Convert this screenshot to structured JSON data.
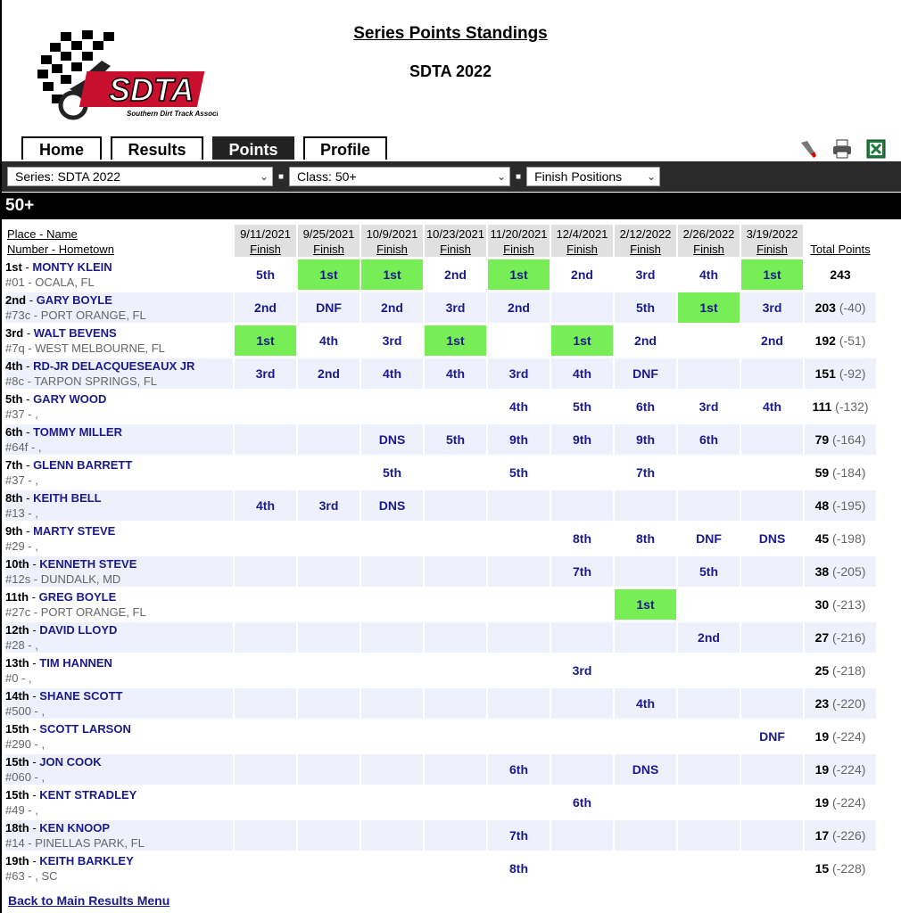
{
  "header": {
    "title": "Series Points Standings",
    "subtitle": "SDTA 2022",
    "logo_text": "SDTA",
    "logo_tagline": "Southern Dirt Track Association"
  },
  "tabs": [
    {
      "label": "Home",
      "active": false
    },
    {
      "label": "Results",
      "active": false
    },
    {
      "label": "Points",
      "active": true
    },
    {
      "label": "Profile",
      "active": false
    }
  ],
  "tools": [
    {
      "icon": "flashlight-icon"
    },
    {
      "icon": "printer-icon"
    },
    {
      "icon": "excel-icon"
    }
  ],
  "filters": {
    "series": "Series: SDTA 2022",
    "class": "Class: 50+",
    "view": "Finish Positions"
  },
  "class_name": "50+",
  "columns": {
    "place_name": "Place - Name",
    "number_hometown": "Number - Hometown",
    "finish_label": "Finish",
    "total_label": "Total Points",
    "dates": [
      "9/11/2021",
      "9/25/2021",
      "10/9/2021",
      "10/23/2021",
      "11/20/2021",
      "12/4/2021",
      "2/12/2022",
      "2/26/2022",
      "3/19/2022"
    ]
  },
  "rows": [
    {
      "place": "1st",
      "name": "MONTY KLEIN",
      "sub": "#01 - OCALA, FL",
      "results": [
        "5th",
        "1st",
        "1st",
        "2nd",
        "1st",
        "2nd",
        "3rd",
        "4th",
        "1st"
      ],
      "total": "243",
      "diff": ""
    },
    {
      "place": "2nd",
      "name": "GARY BOYLE",
      "sub": "#73c - PORT ORANGE, FL",
      "results": [
        "2nd",
        "DNF",
        "2nd",
        "3rd",
        "2nd",
        "",
        "5th",
        "1st",
        "3rd"
      ],
      "total": "203",
      "diff": "(-40)"
    },
    {
      "place": "3rd",
      "name": "WALT BEVENS",
      "sub": "#7q - WEST MELBOURNE, FL",
      "results": [
        "1st",
        "4th",
        "3rd",
        "1st",
        "",
        "1st",
        "2nd",
        "",
        "2nd"
      ],
      "total": "192",
      "diff": "(-51)"
    },
    {
      "place": "4th",
      "name": "RD-JR DELACQUESEAUX JR",
      "sub": "#8c - TARPON SPRINGS, FL",
      "results": [
        "3rd",
        "2nd",
        "4th",
        "4th",
        "3rd",
        "4th",
        "DNF",
        "",
        ""
      ],
      "total": "151",
      "diff": "(-92)"
    },
    {
      "place": "5th",
      "name": "GARY WOOD",
      "sub": "#37 - ,",
      "results": [
        "",
        "",
        "",
        "",
        "4th",
        "5th",
        "6th",
        "3rd",
        "4th"
      ],
      "total": "111",
      "diff": "(-132)"
    },
    {
      "place": "6th",
      "name": "TOMMY MILLER",
      "sub": "#64f - ,",
      "results": [
        "",
        "",
        "DNS",
        "5th",
        "9th",
        "9th",
        "9th",
        "6th",
        ""
      ],
      "total": "79",
      "diff": "(-164)"
    },
    {
      "place": "7th",
      "name": "GLENN BARRETT",
      "sub": "#37 - ,",
      "results": [
        "",
        "",
        "5th",
        "",
        "5th",
        "",
        "7th",
        "",
        ""
      ],
      "total": "59",
      "diff": "(-184)"
    },
    {
      "place": "8th",
      "name": "KEITH BELL",
      "sub": "#13 - ,",
      "results": [
        "4th",
        "3rd",
        "DNS",
        "",
        "",
        "",
        "",
        "",
        ""
      ],
      "total": "48",
      "diff": "(-195)"
    },
    {
      "place": "9th",
      "name": "MARTY STEVE",
      "sub": "#29 - ,",
      "results": [
        "",
        "",
        "",
        "",
        "",
        "8th",
        "8th",
        "DNF",
        "DNS"
      ],
      "total": "45",
      "diff": "(-198)"
    },
    {
      "place": "10th",
      "name": "KENNETH STEVE",
      "sub": "#12s - DUNDALK, MD",
      "results": [
        "",
        "",
        "",
        "",
        "",
        "7th",
        "",
        "5th",
        ""
      ],
      "total": "38",
      "diff": "(-205)"
    },
    {
      "place": "11th",
      "name": "GREG BOYLE",
      "sub": "#27c - PORT ORANGE, FL",
      "results": [
        "",
        "",
        "",
        "",
        "",
        "",
        "1st",
        "",
        ""
      ],
      "total": "30",
      "diff": "(-213)"
    },
    {
      "place": "12th",
      "name": "DAVID LLOYD",
      "sub": "#28 - ,",
      "results": [
        "",
        "",
        "",
        "",
        "",
        "",
        "",
        "2nd",
        ""
      ],
      "total": "27",
      "diff": "(-216)"
    },
    {
      "place": "13th",
      "name": "TIM HANNEN",
      "sub": "#0 - ,",
      "results": [
        "",
        "",
        "",
        "",
        "",
        "3rd",
        "",
        "",
        ""
      ],
      "total": "25",
      "diff": "(-218)"
    },
    {
      "place": "14th",
      "name": "SHANE SCOTT",
      "sub": "#500 - ,",
      "results": [
        "",
        "",
        "",
        "",
        "",
        "",
        "4th",
        "",
        ""
      ],
      "total": "23",
      "diff": "(-220)"
    },
    {
      "place": "15th",
      "name": "SCOTT LARSON",
      "sub": "#290 - ,",
      "results": [
        "",
        "",
        "",
        "",
        "",
        "",
        "",
        "",
        "DNF"
      ],
      "total": "19",
      "diff": "(-224)"
    },
    {
      "place": "15th",
      "name": "JON COOK",
      "sub": "#060 - ,",
      "results": [
        "",
        "",
        "",
        "",
        "6th",
        "",
        "DNS",
        "",
        ""
      ],
      "total": "19",
      "diff": "(-224)"
    },
    {
      "place": "15th",
      "name": "KENT STRADLEY",
      "sub": "#49 - ,",
      "results": [
        "",
        "",
        "",
        "",
        "",
        "6th",
        "",
        "",
        ""
      ],
      "total": "19",
      "diff": "(-224)"
    },
    {
      "place": "18th",
      "name": "KEN KNOOP",
      "sub": "#14 - PINELLAS PARK, FL",
      "results": [
        "",
        "",
        "",
        "",
        "7th",
        "",
        "",
        "",
        ""
      ],
      "total": "17",
      "diff": "(-226)"
    },
    {
      "place": "19th",
      "name": "KEITH BARKLEY",
      "sub": "#63 - , SC",
      "results": [
        "",
        "",
        "",
        "",
        "8th",
        "",
        "",
        "",
        ""
      ],
      "total": "15",
      "diff": "(-228)"
    }
  ],
  "footer": {
    "back_link": "Back to Main Results Menu"
  },
  "colors": {
    "win": "#77ee55",
    "link": "#1a1a8c",
    "alt_row": "#eef1fb"
  }
}
